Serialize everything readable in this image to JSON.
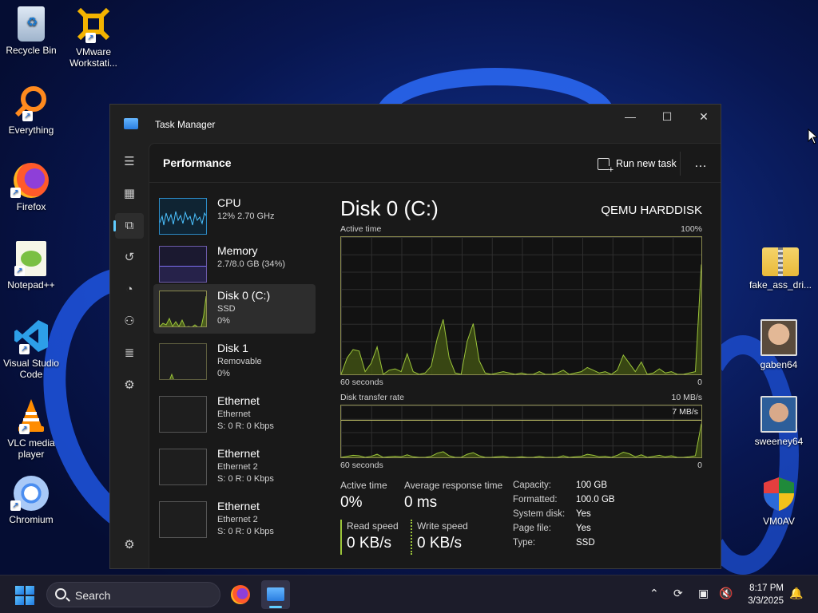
{
  "desktop": {
    "icons": [
      {
        "label": "Recycle Bin",
        "icon": "recycle-bin-icon"
      },
      {
        "label": "VMware Workstati...",
        "icon": "vmware-icon"
      },
      {
        "label": "Everything",
        "icon": "everything-search-icon"
      },
      {
        "label": "Firefox",
        "icon": "firefox-icon"
      },
      {
        "label": "Notepad++",
        "icon": "notepad-plus-plus-icon"
      },
      {
        "label": "Visual Studio Code",
        "icon": "vscode-icon"
      },
      {
        "label": "VLC media player",
        "icon": "vlc-icon"
      },
      {
        "label": "Chromium",
        "icon": "chromium-icon"
      },
      {
        "label": "fake_ass_dri...",
        "icon": "zip-folder-icon"
      },
      {
        "label": "gaben64",
        "icon": "photo-icon"
      },
      {
        "label": "sweeney64",
        "icon": "photo-icon"
      },
      {
        "label": "VM0AV",
        "icon": "shield-icon"
      }
    ]
  },
  "window": {
    "title": "Task Manager",
    "page_title": "Performance",
    "run_new_task": "Run new task",
    "more": "…"
  },
  "devices": [
    {
      "name": "CPU",
      "sub1": "12% 2.70 GHz",
      "sub2": ""
    },
    {
      "name": "Memory",
      "sub1": "2.7/8.0 GB (34%)",
      "sub2": ""
    },
    {
      "name": "Disk 0 (C:)",
      "sub1": "SSD",
      "sub2": "0%"
    },
    {
      "name": "Disk 1",
      "sub1": "Removable",
      "sub2": "0%"
    },
    {
      "name": "Ethernet",
      "sub1": "Ethernet",
      "sub2": "S: 0 R: 0 Kbps"
    },
    {
      "name": "Ethernet",
      "sub1": "Ethernet 2",
      "sub2": "S: 0 R: 0 Kbps"
    },
    {
      "name": "Ethernet",
      "sub1": "Ethernet 2",
      "sub2": "S: 0 R: 0 Kbps"
    }
  ],
  "detail": {
    "title": "Disk 0 (C:)",
    "model": "QEMU HARDDISK",
    "active_time_label": "Active time",
    "active_time_max": "100%",
    "active_time_xlabel": "60 seconds",
    "active_time_xmin": "0",
    "transfer_label": "Disk transfer rate",
    "transfer_max": "10 MB/s",
    "transfer_line_label": "7 MB/s",
    "transfer_xlabel": "60 seconds",
    "transfer_xmin": "0",
    "stats": {
      "active_time_label": "Active time",
      "active_time_value": "0%",
      "avg_response_label": "Average response time",
      "avg_response_value": "0 ms",
      "read_label": "Read speed",
      "read_value": "0 KB/s",
      "write_label": "Write speed",
      "write_value": "0 KB/s"
    },
    "properties": [
      {
        "key": "Capacity:",
        "value": "100 GB"
      },
      {
        "key": "Formatted:",
        "value": "100.0 GB"
      },
      {
        "key": "System disk:",
        "value": "Yes"
      },
      {
        "key": "Page file:",
        "value": "Yes"
      },
      {
        "key": "Type:",
        "value": "SSD"
      }
    ]
  },
  "chart_data": [
    {
      "type": "area",
      "title": "Active time",
      "ylim": [
        0,
        100
      ],
      "x": [
        0,
        1,
        2,
        3,
        4,
        5,
        6,
        7,
        8,
        9,
        10,
        11,
        12,
        13,
        14,
        15,
        16,
        17,
        18,
        19,
        20,
        21,
        22,
        23,
        24,
        25,
        26,
        27,
        28,
        29,
        30,
        31,
        32,
        33,
        34,
        35,
        36,
        37,
        38,
        39,
        40,
        41,
        42,
        43,
        44,
        45,
        46,
        47,
        48,
        49,
        50,
        51,
        52,
        53,
        54,
        55,
        56,
        57,
        58,
        59,
        60
      ],
      "series": [
        {
          "name": "",
          "values": [
            0,
            12,
            18,
            17,
            2,
            8,
            20,
            0,
            3,
            4,
            2,
            15,
            2,
            0,
            1,
            6,
            26,
            40,
            12,
            1,
            0,
            24,
            37,
            10,
            1,
            0,
            1,
            2,
            1,
            0,
            1,
            0,
            0,
            2,
            0,
            0,
            1,
            3,
            0,
            1,
            2,
            5,
            3,
            1,
            2,
            0,
            3,
            14,
            8,
            2,
            9,
            0,
            1,
            4,
            1,
            2,
            0,
            0,
            1,
            2,
            80
          ]
        }
      ]
    },
    {
      "type": "area",
      "title": "Disk transfer rate",
      "ylim": [
        0,
        10
      ],
      "x": [
        0,
        1,
        2,
        3,
        4,
        5,
        6,
        7,
        8,
        9,
        10,
        11,
        12,
        13,
        14,
        15,
        16,
        17,
        18,
        19,
        20,
        21,
        22,
        23,
        24,
        25,
        26,
        27,
        28,
        29,
        30,
        31,
        32,
        33,
        34,
        35,
        36,
        37,
        38,
        39,
        40,
        41,
        42,
        43,
        44,
        45,
        46,
        47,
        48,
        49,
        50,
        51,
        52,
        53,
        54,
        55,
        56,
        57,
        58,
        59,
        60
      ],
      "series": [
        {
          "name": "",
          "values": [
            0,
            0.2,
            0.4,
            0.3,
            0,
            0.2,
            0.6,
            0,
            0.1,
            0.2,
            0.1,
            0.5,
            0.1,
            0,
            0,
            0.2,
            0.8,
            1.1,
            0.3,
            0,
            0,
            0.6,
            0.9,
            0.3,
            0,
            0,
            0.1,
            0.2,
            0,
            0,
            0.1,
            0,
            0,
            0.2,
            0,
            0,
            0,
            0.3,
            0,
            0.1,
            0.2,
            0.6,
            0.4,
            0.1,
            0.2,
            0,
            0.4,
            1.0,
            0.7,
            0.1,
            0.5,
            0,
            0.2,
            0.4,
            0.1,
            0.3,
            0,
            0,
            0.1,
            0.3,
            6.5
          ]
        }
      ]
    }
  ],
  "taskbar": {
    "search_placeholder": "Search",
    "time": "8:17 PM",
    "date": "3/3/2025"
  }
}
